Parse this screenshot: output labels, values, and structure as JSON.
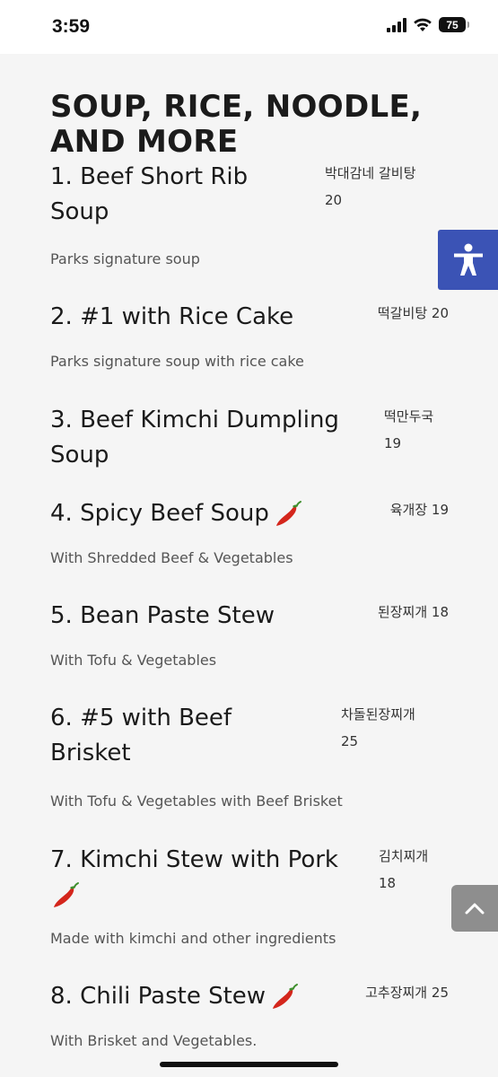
{
  "status_bar": {
    "time": "3:59",
    "battery": "75"
  },
  "section_title": "SOUP, RICE, NOODLE, AND MORE",
  "menu_items": [
    {
      "name": "1. Beef Short Rib Soup",
      "korean": "박대감네 갈비탕",
      "price": "20",
      "description": "Parks signature soup",
      "spicy": false
    },
    {
      "name": "2. #1 with Rice Cake",
      "korean": "떡갈비탕",
      "price": "20",
      "description": "Parks signature soup with rice cake",
      "spicy": false
    },
    {
      "name": "3. Beef Kimchi Dumpling Soup",
      "korean": "떡만두국",
      "price": "19",
      "description": "",
      "spicy": false
    },
    {
      "name": "4. Spicy Beef Soup",
      "korean": "육개장",
      "price": "19",
      "description": "With Shredded Beef & Vegetables",
      "spicy": true
    },
    {
      "name": "5. Bean Paste Stew",
      "korean": "된장찌개",
      "price": "18",
      "description": "With Tofu & Vegetables",
      "spicy": false
    },
    {
      "name": "6. #5 with Beef Brisket",
      "korean": "차돌된장찌개",
      "price": "25",
      "description": "With Tofu & Vegetables with Beef Brisket",
      "spicy": false
    },
    {
      "name": "7. Kimchi Stew with Pork",
      "korean": "김치찌개",
      "price": "18",
      "description": "Made with kimchi and other ingredients",
      "spicy": true
    },
    {
      "name": "8. Chili Paste Stew",
      "korean": "고추장찌개",
      "price": "25",
      "description": "With Brisket and Vegetables.",
      "spicy": true
    }
  ],
  "colors": {
    "accessibility_button": "#3b53b5",
    "scroll_top_button": "#8e8e8e",
    "chili": "#d4261c"
  },
  "icons": {
    "accessibility": "accessibility-person-icon",
    "scroll_top": "chevron-up-icon",
    "spicy": "chili-pepper-icon"
  }
}
